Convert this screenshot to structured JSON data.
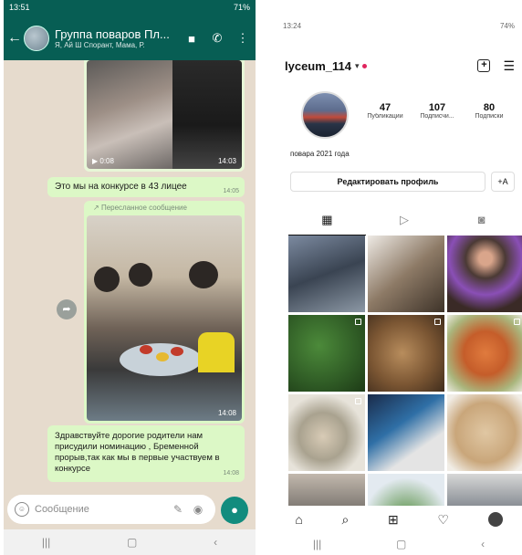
{
  "whatsapp": {
    "status_time": "13:51",
    "status_right": "71%",
    "chat_title": "Группа поваров Пл...",
    "chat_subtitle": "Я, Ай Ш Спорант, Мама, Р.",
    "video_duration": "0:08",
    "image1_time": "14:03",
    "message1": "Это мы на конкурсе в 43 лицее",
    "message1_time": "14:05",
    "forwarded_label": "Пересланное сообщение",
    "image2_time": "14:08",
    "message2": "Здравствуйте дорогие родители нам присудили номинацию , Бременной прорыв,так как мы в первые участвуем в конкурсе",
    "message2_time": "14:08",
    "input_placeholder": "Сообщение"
  },
  "instagram": {
    "status_time": "13:24",
    "status_right": "74%",
    "username": "lyceum_114",
    "stats": [
      {
        "value": "47",
        "label": "Публикации"
      },
      {
        "value": "107",
        "label": "Подписчи..."
      },
      {
        "value": "80",
        "label": "Подписки"
      }
    ],
    "bio": "повара 2021 года",
    "edit_profile": "Редактировать профиль"
  },
  "icons": {
    "back": "arrow-left-icon",
    "video_call": "video-icon",
    "call": "phone-icon",
    "more": "dots-vertical-icon",
    "emoji": "emoji-icon",
    "attach": "paperclip-icon",
    "camera": "camera-icon",
    "mic": "mic-icon",
    "grid": "grid-icon",
    "reels": "reels-icon",
    "tagged": "tagged-icon",
    "home": "home-icon",
    "search": "search-icon",
    "add": "add-post-icon",
    "heart": "heart-icon"
  },
  "colors": {
    "whatsapp_header": "#075e54",
    "bubble_out": "#dcf8c6",
    "whatsapp_mic": "#128c7e"
  }
}
